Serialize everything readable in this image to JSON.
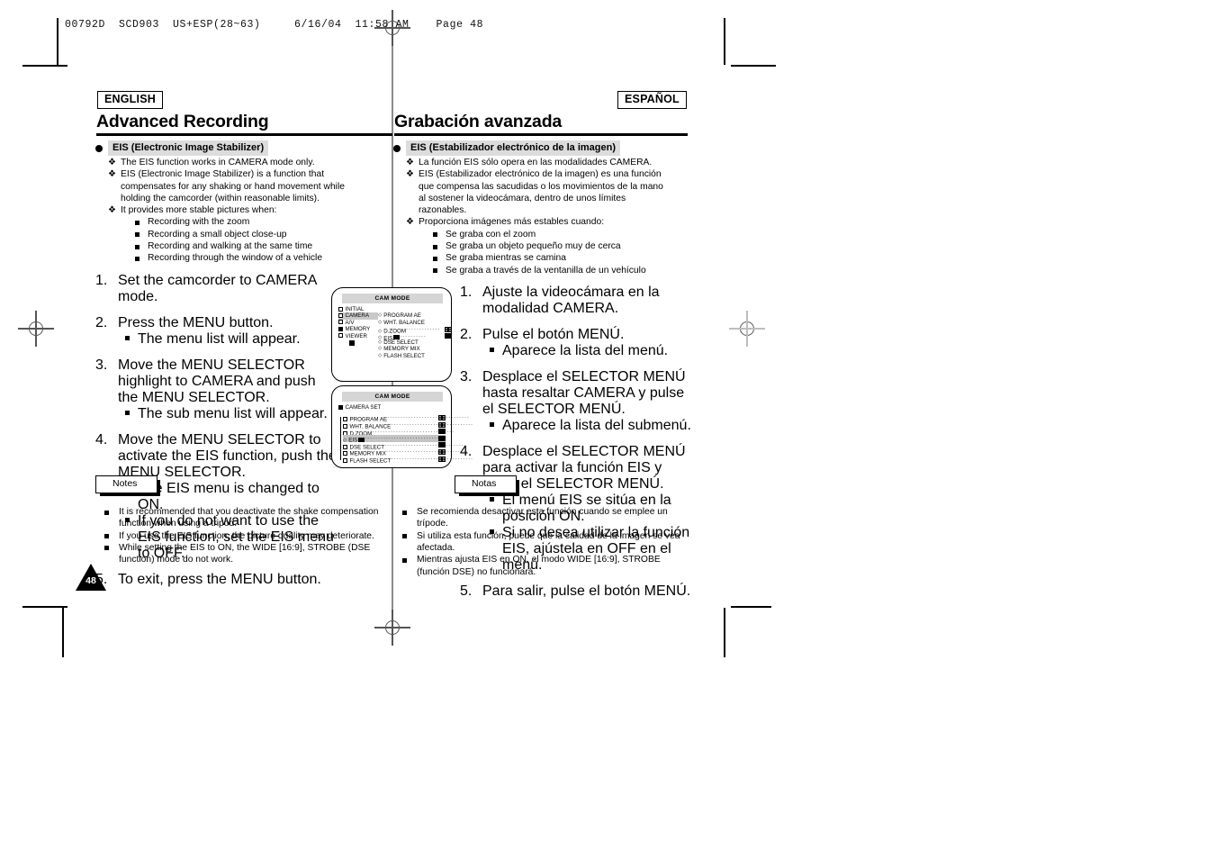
{
  "print_slug": "00792D  SCD903  US+ESP(28~63)     6/16/04  11:58 AM    Page 48",
  "page_number": "48",
  "english": {
    "language_tag": "ENGLISH",
    "chapter_title": "Advanced Recording",
    "section_heading": "EIS (Electronic Image Stabilizer)",
    "bullets": [
      {
        "text": "The EIS function works in CAMERA mode only.",
        "marker": "❖"
      },
      {
        "text": "EIS (Electronic Image Stabilizer) is a function that compensates for any shaking or hand movement while holding the camcorder (within reasonable limits).",
        "marker": "❖"
      },
      {
        "text": "It provides more stable pictures when:",
        "marker": "❖",
        "subitems": [
          "Recording with the zoom",
          "Recording a small object close-up",
          "Recording and walking at the same time",
          "Recording through the window of a vehicle"
        ]
      }
    ],
    "steps": [
      {
        "num": "1.",
        "text": "Set the camcorder to CAMERA mode.",
        "subitems": []
      },
      {
        "num": "2.",
        "text": "Press the MENU button.",
        "subitems": [
          "The menu list will appear."
        ]
      },
      {
        "num": "3.",
        "text": "Move the MENU SELECTOR highlight to CAMERA and push the MENU SELECTOR.",
        "subitems": [
          "The sub menu list will appear."
        ]
      },
      {
        "num": "4.",
        "text": "Move the MENU SELECTOR to activate the EIS function, push the MENU SELECTOR.",
        "subitems": [
          "The EIS menu is changed to ON.",
          "If you do not want to use the EIS function, set the EIS menu to OFF."
        ]
      },
      {
        "num": "5.",
        "text": "To exit, press the MENU button.",
        "subitems": []
      }
    ],
    "notes_label": "Notes",
    "notes": [
      "It is recommended that you deactivate the shake compensation function when using a tripod.",
      "If you use the EIS function, the picture quality may deteriorate.",
      "While setting the EIS to ON, the WIDE [16:9], STROBE (DSE function) mode do not work."
    ]
  },
  "spanish": {
    "language_tag": "ESPAÑOL",
    "chapter_title": "Grabación avanzada",
    "section_heading": "EIS (Estabilizador electrónico de la imagen)",
    "bullets": [
      {
        "text": "La función EIS sólo opera en las modalidades CAMERA.",
        "marker": "❖"
      },
      {
        "text": "EIS (Estabilizador electrónico de la imagen) es una función que compensa las sacudidas o los movimientos de la mano al sostener la videocámara, dentro de unos límites razonables.",
        "marker": "❖"
      },
      {
        "text": "Proporciona imágenes más estables cuando:",
        "marker": "❖",
        "subitems": [
          "Se graba con el zoom",
          "Se graba un objeto pequeño muy de cerca",
          "Se graba mientras se camina",
          "Se graba a través de la ventanilla de un vehículo"
        ]
      }
    ],
    "steps": [
      {
        "num": "1.",
        "text": "Ajuste la videocámara en la modalidad CAMERA.",
        "subitems": []
      },
      {
        "num": "2.",
        "text": "Pulse el botón MENÚ.",
        "subitems": [
          "Aparece la lista del menú."
        ]
      },
      {
        "num": "3.",
        "text": "Desplace el SELECTOR MENÚ hasta resaltar CAMERA y pulse el SELECTOR MENÚ.",
        "subitems": [
          "Aparece la lista del submenú."
        ]
      },
      {
        "num": "4.",
        "text": "Desplace el SELECTOR MENÚ para activar la función EIS y pulse el SELECTOR MENÚ.",
        "subitems": [
          "El menú EIS se sitúa en la posición ON.",
          "Si no desea utilizar la función EIS, ajústela en OFF en el menú."
        ]
      },
      {
        "num": "5.",
        "text": "Para salir, pulse el botón MENÚ.",
        "subitems": []
      }
    ],
    "notes_label": "Notas",
    "notes": [
      "Se recomienda desactivar esta función cuando se emplee un trípode.",
      "Si utiliza esta función, puede que la calidad de la imagen se vea afectada.",
      "Mientras ajusta EIS en ON, el modo WIDE [16:9], STROBE (función DSE) no funcionará."
    ]
  },
  "lcd_screens": [
    {
      "title": "CAM MODE",
      "left_menu": [
        "INITIAL",
        "CAMERA",
        "A/V",
        "MEMORY",
        "VIEWER"
      ],
      "left_selected": "CAMERA",
      "right_menu": [
        "PROGRAM AE",
        "WHT. BALANCE",
        "D.ZOOM",
        "EIS",
        "DSE SELECT",
        "MEMORY MIX",
        "FLASH SELECT"
      ]
    },
    {
      "title": "CAM MODE",
      "header": "CAMERA SET",
      "items": [
        "PROGRAM AE",
        "WHT. BALANCE",
        "D.ZOOM",
        "EIS",
        "DSE SELECT",
        "MEMORY MIX",
        "FLASH SELECT"
      ],
      "selected": "EIS"
    }
  ]
}
